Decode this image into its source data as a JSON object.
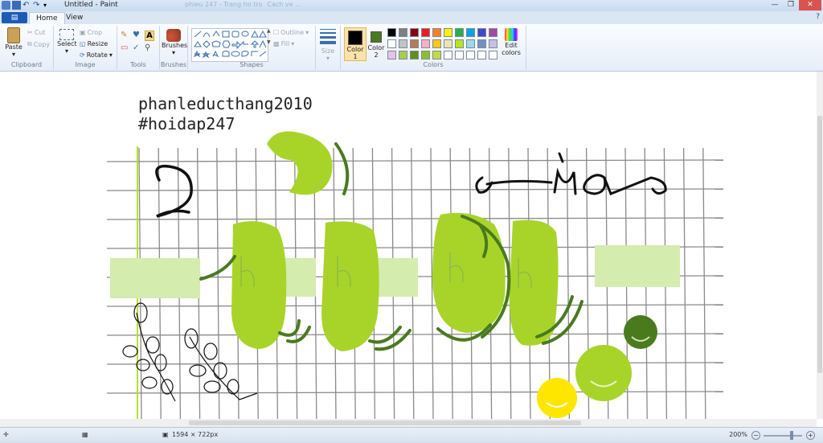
{
  "window": {
    "title": "Untitled - Paint",
    "ghost_tab_1": "phieu 247 - Trang ho tro",
    "ghost_tab_2": "Cach ve ..."
  },
  "tabs": {
    "file": "▤",
    "home": "Home",
    "view": "View"
  },
  "clipboard": {
    "paste": "Paste",
    "cut": "Cut",
    "copy": "Copy",
    "label": "Clipboard"
  },
  "image": {
    "select": "Select",
    "crop": "Crop",
    "resize": "Resize",
    "rotate": "Rotate",
    "label": "Image"
  },
  "tools": {
    "label": "Tools"
  },
  "brushes": {
    "label": "Brushes"
  },
  "shapes": {
    "outline": "Outline",
    "fill": "Fill",
    "label": "Shapes"
  },
  "size": {
    "label": "Size"
  },
  "colors": {
    "color1": "Color",
    "color1_num": "1",
    "color2": "Color",
    "color2_num": "2",
    "edit": "Edit",
    "edit2": "colors",
    "label": "Colors",
    "color1_value": "#000000",
    "color2_value": "#4a7a1e",
    "palette_row1": [
      "#000000",
      "#7f7f7f",
      "#880015",
      "#ed1c24",
      "#ff7f27",
      "#fff200",
      "#22b14c",
      "#00a2e8",
      "#3f48cc",
      "#a349a4"
    ],
    "palette_row2": [
      "#ffffff",
      "#c3c3c3",
      "#b97a57",
      "#ffaec9",
      "#ffc90e",
      "#efe4b0",
      "#b5e61d",
      "#99d9ea",
      "#7092be",
      "#c8bfe7"
    ],
    "palette_row3": [
      "#e8c2e6",
      "#a6cf47",
      "#5f8f1f",
      "#8bc22b",
      "#c4dc3b",
      "#ffffff",
      "#ffffff",
      "#ffffff",
      "#ffffff",
      "#ffffff"
    ]
  },
  "canvas": {
    "line1": "phanleducthang2010",
    "line2": "#hoidap247",
    "lime": "#a8d42a",
    "lime_light": "#d4ecae",
    "dark_green": "#4a7a1e",
    "yellow": "#ffe600"
  },
  "status": {
    "dimensions": "1594 × 722px",
    "zoom": "200%"
  }
}
